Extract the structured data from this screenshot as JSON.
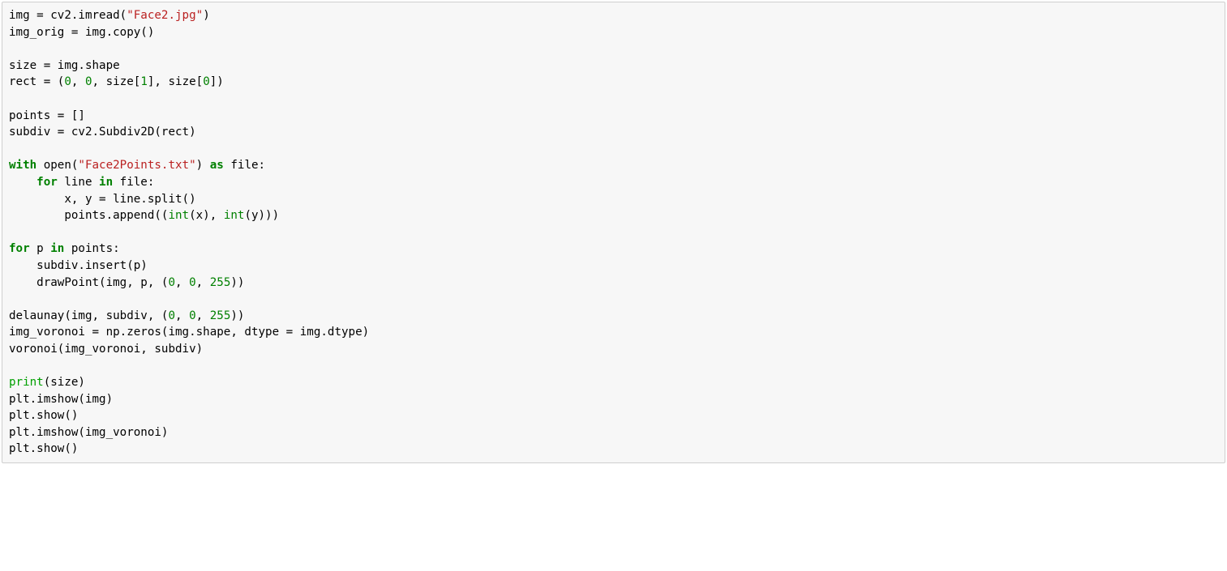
{
  "code": {
    "line1": {
      "a": "img = cv2.imread(",
      "str": "\"Face2.jpg\"",
      "b": ")"
    },
    "line2": {
      "a": "img_orig = img.copy()"
    },
    "line4": {
      "a": "size = img.shape"
    },
    "line5": {
      "a": "rect = (",
      "n1": "0",
      "b": ", ",
      "n2": "0",
      "c": ", size[",
      "n3": "1",
      "d": "], size[",
      "n4": "0",
      "e": "])"
    },
    "line7": {
      "a": "points = []"
    },
    "line8": {
      "a": "subdiv = cv2.Subdiv2D(rect)"
    },
    "line10": {
      "kw1": "with",
      "a": " open(",
      "str": "\"Face2Points.txt\"",
      "b": ") ",
      "kw2": "as",
      "c": " file:"
    },
    "line11": {
      "indent": "    ",
      "kw1": "for",
      "a": " line ",
      "kw2": "in",
      "b": " file:"
    },
    "line12": {
      "indent": "        ",
      "a": "x, y = line.split()"
    },
    "line13": {
      "indent": "        ",
      "a": "points.append((",
      "bltn1": "int",
      "b": "(x), ",
      "bltn2": "int",
      "c": "(y)))"
    },
    "line15": {
      "kw1": "for",
      "a": " p ",
      "kw2": "in",
      "b": " points:"
    },
    "line16": {
      "indent": "    ",
      "a": "subdiv.insert(p)"
    },
    "line17": {
      "indent": "    ",
      "a": "drawPoint(img, p, (",
      "n1": "0",
      "b": ", ",
      "n2": "0",
      "c": ", ",
      "n3": "255",
      "d": "))"
    },
    "line19": {
      "a": "delaunay(img, subdiv, (",
      "n1": "0",
      "b": ", ",
      "n2": "0",
      "c": ", ",
      "n3": "255",
      "d": "))"
    },
    "line20": {
      "a": "img_voronoi = np.zeros(img.shape, dtype = img.dtype)"
    },
    "line21": {
      "a": "voronoi(img_voronoi, subdiv)"
    },
    "line23": {
      "fn": "print",
      "a": "(size)"
    },
    "line24": {
      "a": "plt.imshow(img)"
    },
    "line25": {
      "a": "plt.show()"
    },
    "line26": {
      "a": "plt.imshow(img_voronoi)"
    },
    "line27": {
      "a": "plt.show()"
    }
  }
}
